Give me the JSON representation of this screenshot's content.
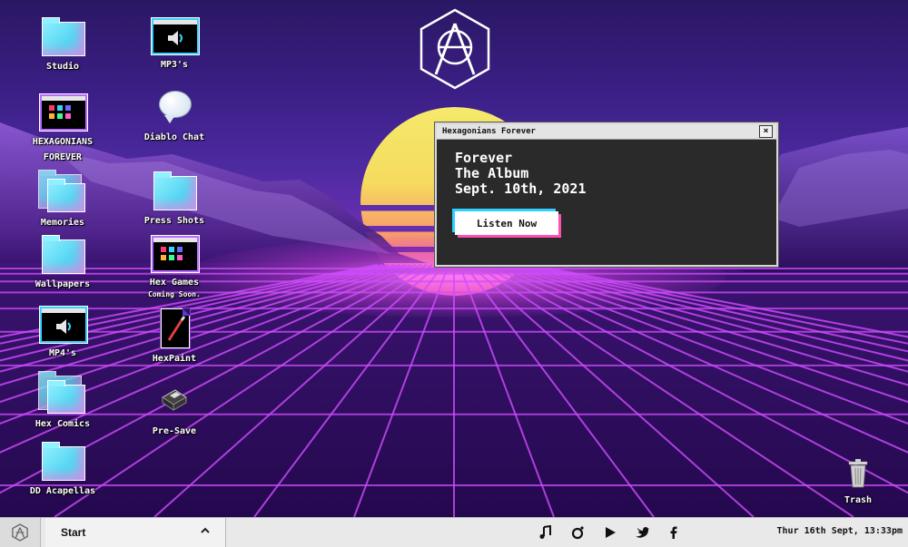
{
  "desktop": {
    "icons": [
      {
        "label": "Studio",
        "icon": "folder-icon"
      },
      {
        "label": "HEXAGONIANS FOREVER",
        "icon": "window-icon"
      },
      {
        "label": "Memories",
        "icon": "folder-stack-icon"
      },
      {
        "label": "Wallpapers",
        "icon": "folder-icon"
      },
      {
        "label": "MP4's",
        "icon": "video-icon"
      },
      {
        "label": "Hex Comics",
        "icon": "folder-stack-icon"
      },
      {
        "label": "DD Acapellas",
        "icon": "folder-icon"
      },
      {
        "label": "MP3's",
        "icon": "speaker-icon"
      },
      {
        "label": "Diablo Chat",
        "icon": "chat-bubble-icon"
      },
      {
        "label": "Press Shots",
        "icon": "folder-icon"
      },
      {
        "label": "Hex Games",
        "sublabel": "Coming Soon.",
        "icon": "window-icon"
      },
      {
        "label": "HexPaint",
        "icon": "paint-document-icon"
      },
      {
        "label": "Pre-Save",
        "icon": "floppy-disk-icon"
      },
      {
        "label": "Trash",
        "icon": "trash-icon"
      }
    ]
  },
  "popup": {
    "title": "Hexagonians Forever",
    "lines": [
      "Forever",
      "The Album",
      "Sept. 10th, 2021"
    ],
    "button_label": "Listen Now"
  },
  "taskbar": {
    "start_label": "Start",
    "social_icons": [
      "music-note-icon",
      "instagram-icon",
      "play-icon",
      "twitter-icon",
      "facebook-icon"
    ],
    "clock": "Thur 16th Sept, 13:33pm"
  },
  "colors": {
    "accent_cyan": "#2ed1ff",
    "accent_pink": "#ff4fb0",
    "grid_magenta": "#d04cff",
    "taskbar": "#e9e9e9"
  }
}
